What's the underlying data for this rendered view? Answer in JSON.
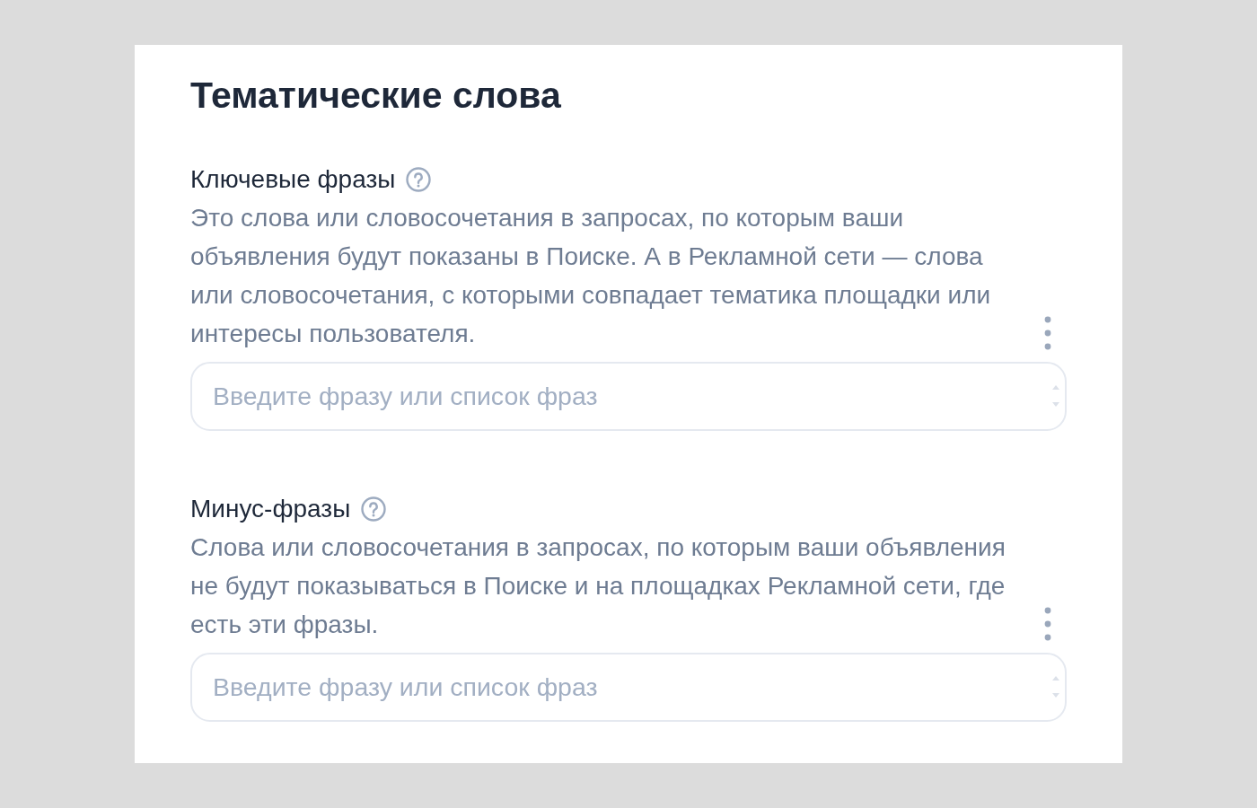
{
  "title": "Тематические слова",
  "sections": [
    {
      "label": "Ключевые фразы",
      "description": "Это слова или словосочетания в запросах, по которым ваши объявления будут показаны в Поиске. А в Рекламной сети — слова или словосочетания, с которыми совпадает тематика площадки или интересы пользователя.",
      "input": {
        "placeholder": "Введите фразу или список фраз"
      }
    },
    {
      "label": "Минус-фразы",
      "description": "Слова или словосочетания в запросах, по которым ваши объявления не будут показываться в Поиске и на площадках Рекламной сети, где есть эти фразы.",
      "input": {
        "placeholder": "Введите фразу или список фраз"
      }
    }
  ]
}
